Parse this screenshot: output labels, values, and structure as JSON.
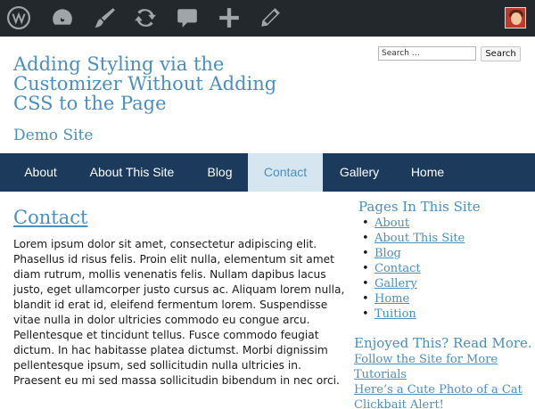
{
  "admin_bar": {
    "icons": [
      "wordpress-icon",
      "dashboard-icon",
      "customize-brush-icon",
      "updates-icon",
      "comments-icon",
      "new-content-icon",
      "edit-icon"
    ],
    "background": "#23282d"
  },
  "header": {
    "site_title": "Adding Styling via the Customizer Without Adding CSS to the Page",
    "site_description": "Demo Site",
    "search_placeholder": "Search …",
    "search_button": "Search"
  },
  "nav": {
    "items": [
      {
        "label": "About"
      },
      {
        "label": "About This Site"
      },
      {
        "label": "Blog"
      },
      {
        "label": "Contact"
      },
      {
        "label": "Gallery"
      },
      {
        "label": "Home"
      }
    ],
    "active": "Contact",
    "background": "#1b3a5c",
    "active_background": "#d5e6f0"
  },
  "main": {
    "title": "Contact",
    "body": "Lorem ipsum dolor sit amet, consectetur adipiscing elit. Phasellus id risus felis. Proin elit nulla, elementum sit amet diam rutrum, mollis venenatis felis. Nullam dapibus lacus justo, eget ullamcorper justo cursus ac. Aliquam lorem nulla, blandit id erat id, eleifend fermentum lorem. Suspendisse vitae nulla in dolor ultricies commodo eu congue arcu. Pellentesque et tincidunt tellus. Fusce commodo feugiat dictum. In hac habitasse platea dictumst. Morbi dignissim pellentesque ipsum, sed sollicitudin nulla ultricies in. Praesent eu mi sed massa sollicitudin bibendum in nec orci."
  },
  "sidebar": {
    "pages_title": "Pages In This Site",
    "pages": [
      "About",
      "About This Site",
      "Blog",
      "Contact",
      "Gallery",
      "Home",
      "Tuition"
    ],
    "enjoy_title": "Enjoyed This? Read More.",
    "enjoy_links": [
      "Follow the Site for More Tutorials",
      "Here’s a Cute Photo of a Cat",
      "Clickbait Alert!"
    ]
  },
  "colors": {
    "link": "#4a8fc0",
    "text": "#1a1a1a"
  }
}
